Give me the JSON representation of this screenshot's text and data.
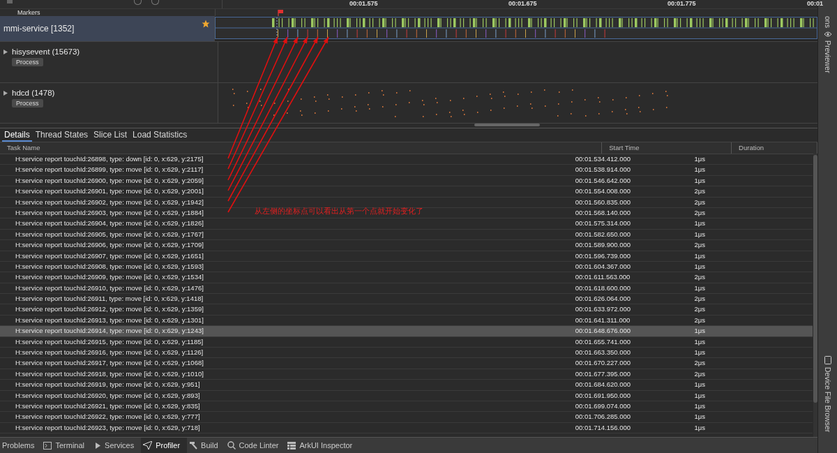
{
  "timeline": {
    "ticks": [
      "00:01.575",
      "00:01.675",
      "00:01.775",
      "00:01"
    ],
    "markers_label": "Markers",
    "tracks": [
      {
        "name": "mmi-service [1352]",
        "selected": true,
        "starred": true,
        "kind": "thread"
      },
      {
        "name": "hisysevent (15673)",
        "selected": false,
        "starred": false,
        "kind": "process",
        "tag": "Process"
      },
      {
        "name": "hdcd (1478)",
        "selected": false,
        "starred": false,
        "kind": "process",
        "tag": "Process"
      }
    ]
  },
  "tabs": [
    {
      "label": "Details",
      "selected": true
    },
    {
      "label": "Thread States",
      "selected": false
    },
    {
      "label": "Slice List",
      "selected": false
    },
    {
      "label": "Load Statistics",
      "selected": false
    }
  ],
  "table": {
    "columns": [
      "Task Name",
      "Start Time",
      "Duration"
    ],
    "rows": [
      {
        "name": "H:service report touchId:26898, type: down [id: 0, x:629, y:2175]",
        "start": "00:01.534.412.000",
        "duration": "1μs",
        "selected": false
      },
      {
        "name": "H:service report touchId:26899, type: move [id: 0, x:629, y:2117]",
        "start": "00:01.538.914.000",
        "duration": "1μs",
        "selected": false
      },
      {
        "name": "H:service report touchId:26900, type: move [id: 0, x:629, y:2059]",
        "start": "00:01.546.642.000",
        "duration": "1μs",
        "selected": false
      },
      {
        "name": "H:service report touchId:26901, type: move [id: 0, x:629, y:2001]",
        "start": "00:01.554.008.000",
        "duration": "2μs",
        "selected": false
      },
      {
        "name": "H:service report touchId:26902, type: move [id: 0, x:629, y:1942]",
        "start": "00:01.560.835.000",
        "duration": "2μs",
        "selected": false
      },
      {
        "name": "H:service report touchId:26903, type: move [id: 0, x:629, y:1884]",
        "start": "00:01.568.140.000",
        "duration": "2μs",
        "selected": false
      },
      {
        "name": "H:service report touchId:26904, type: move [id: 0, x:629, y:1826]",
        "start": "00:01.575.314.000",
        "duration": "1μs",
        "selected": false
      },
      {
        "name": "H:service report touchId:26905, type: move [id: 0, x:629, y:1767]",
        "start": "00:01.582.650.000",
        "duration": "1μs",
        "selected": false
      },
      {
        "name": "H:service report touchId:26906, type: move [id: 0, x:629, y:1709]",
        "start": "00:01.589.900.000",
        "duration": "2μs",
        "selected": false
      },
      {
        "name": "H:service report touchId:26907, type: move [id: 0, x:629, y:1651]",
        "start": "00:01.596.739.000",
        "duration": "1μs",
        "selected": false
      },
      {
        "name": "H:service report touchId:26908, type: move [id: 0, x:629, y:1593]",
        "start": "00:01.604.367.000",
        "duration": "1μs",
        "selected": false
      },
      {
        "name": "H:service report touchId:26909, type: move [id: 0, x:629, y:1534]",
        "start": "00:01.611.563.000",
        "duration": "2μs",
        "selected": false
      },
      {
        "name": "H:service report touchId:26910, type: move [id: 0, x:629, y:1476]",
        "start": "00:01.618.600.000",
        "duration": "1μs",
        "selected": false
      },
      {
        "name": "H:service report touchId:26911, type: move [id: 0, x:629, y:1418]",
        "start": "00:01.626.064.000",
        "duration": "2μs",
        "selected": false
      },
      {
        "name": "H:service report touchId:26912, type: move [id: 0, x:629, y:1359]",
        "start": "00:01.633.972.000",
        "duration": "2μs",
        "selected": false
      },
      {
        "name": "H:service report touchId:26913, type: move [id: 0, x:629, y:1301]",
        "start": "00:01.641.311.000",
        "duration": "2μs",
        "selected": false
      },
      {
        "name": "H:service report touchId:26914, type: move [id: 0, x:629, y:1243]",
        "start": "00:01.648.676.000",
        "duration": "1μs",
        "selected": true
      },
      {
        "name": "H:service report touchId:26915, type: move [id: 0, x:629, y:1185]",
        "start": "00:01.655.741.000",
        "duration": "1μs",
        "selected": false
      },
      {
        "name": "H:service report touchId:26916, type: move [id: 0, x:629, y:1126]",
        "start": "00:01.663.350.000",
        "duration": "1μs",
        "selected": false
      },
      {
        "name": "H:service report touchId:26917, type: move [id: 0, x:629, y:1068]",
        "start": "00:01.670.227.000",
        "duration": "2μs",
        "selected": false
      },
      {
        "name": "H:service report touchId:26918, type: move [id: 0, x:629, y:1010]",
        "start": "00:01.677.395.000",
        "duration": "2μs",
        "selected": false
      },
      {
        "name": "H:service report touchId:26919, type: move [id: 0, x:629, y:951]",
        "start": "00:01.684.620.000",
        "duration": "1μs",
        "selected": false
      },
      {
        "name": "H:service report touchId:26920, type: move [id: 0, x:629, y:893]",
        "start": "00:01.691.950.000",
        "duration": "1μs",
        "selected": false
      },
      {
        "name": "H:service report touchId:26921, type: move [id: 0, x:629, y:835]",
        "start": "00:01.699.074.000",
        "duration": "1μs",
        "selected": false
      },
      {
        "name": "H:service report touchId:26922, type: move [id: 0, x:629, y:777]",
        "start": "00:01.706.285.000",
        "duration": "1μs",
        "selected": false
      },
      {
        "name": "H:service report touchId:26923, type: move [id: 0, x:629, y:718]",
        "start": "00:01.714.156.000",
        "duration": "1μs",
        "selected": false
      }
    ]
  },
  "annotation": "从左侧的坐标点可以看出从第一个点就开始变化了",
  "side_tools": [
    {
      "label": "ons",
      "kind": "cut"
    },
    {
      "label": "Previewer",
      "kind": "eye"
    },
    {
      "label": "Device File Browser",
      "kind": "device"
    }
  ],
  "bottom_tabs": [
    {
      "label": "Problems",
      "kind": "none",
      "selected": false
    },
    {
      "label": "Terminal",
      "kind": "terminal",
      "selected": false
    },
    {
      "label": "Services",
      "kind": "services",
      "selected": false
    },
    {
      "label": "Profiler",
      "kind": "profiler",
      "selected": true
    },
    {
      "label": "Build",
      "kind": "build",
      "selected": false
    },
    {
      "label": "Code Linter",
      "kind": "linter",
      "selected": false
    },
    {
      "label": "ArkUI Inspector",
      "kind": "inspector",
      "selected": false
    }
  ]
}
